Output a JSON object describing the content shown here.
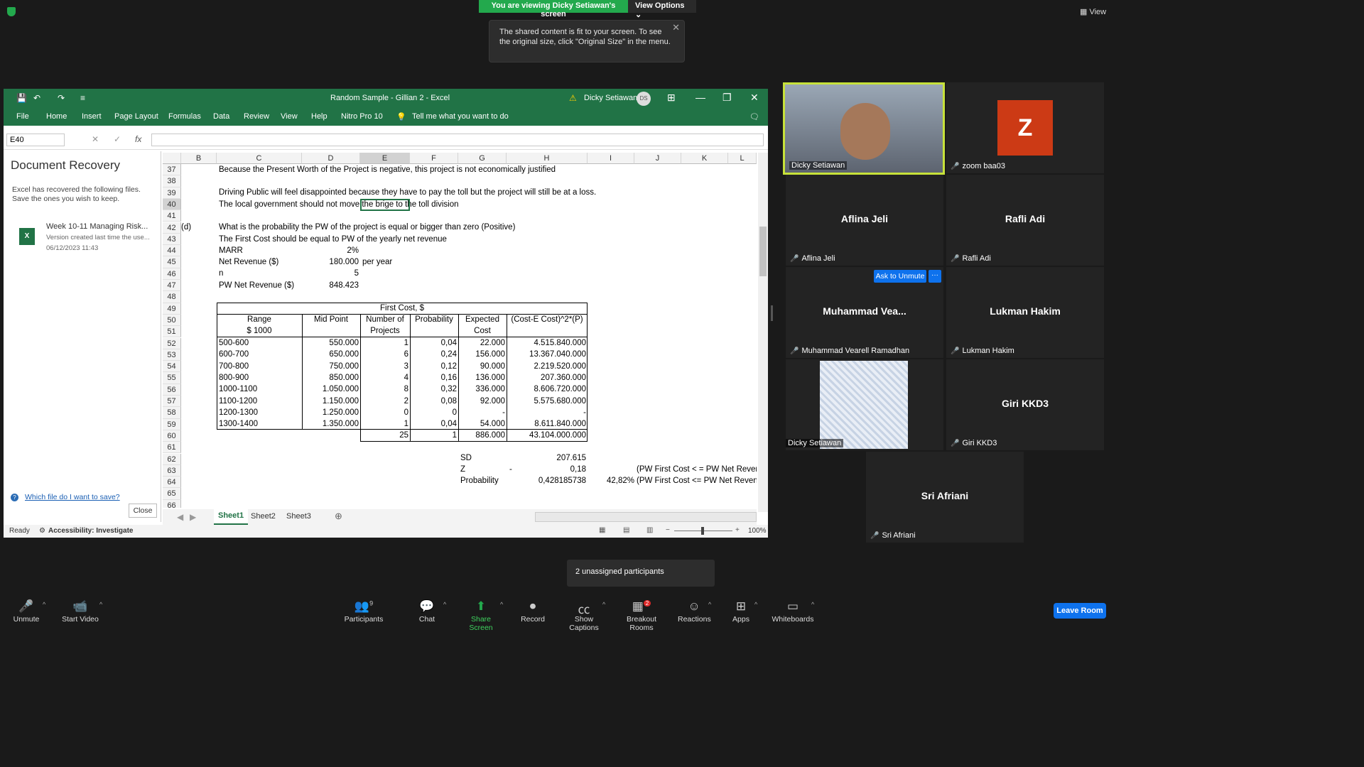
{
  "share": {
    "banner": "You are viewing Dicky Setiawan's screen",
    "view_options": "View Options",
    "view": "View",
    "tip": "The shared content is fit to your screen. To see the original size, click \"Original Size\" in the menu."
  },
  "excel": {
    "title": "Random Sample - Gillian 2  -  Excel",
    "user": "Dicky Setiawan",
    "user_initials": "DS",
    "menu": [
      "File",
      "Home",
      "Insert",
      "Page Layout",
      "Formulas",
      "Data",
      "Review",
      "View",
      "Help",
      "Nitro Pro 10",
      "Tell me what you want to do"
    ],
    "namebox": "E40",
    "fx": "fx",
    "recovery": {
      "title": "Document Recovery",
      "desc": "Excel has recovered the following files.  Save the ones you wish to keep.",
      "file": "Week 10-11 Managing Risk...",
      "version": "Version created last time the use...",
      "date": "06/12/2023 11:43",
      "help": "Which file do I want to save?",
      "close": "Close"
    },
    "columns": [
      "B",
      "C",
      "D",
      "E",
      "F",
      "G",
      "H",
      "I",
      "J",
      "K",
      "L"
    ],
    "rows": [
      "37",
      "38",
      "39",
      "40",
      "41",
      "42",
      "43",
      "44",
      "45",
      "46",
      "47",
      "48",
      "49",
      "50",
      "51",
      "52",
      "53",
      "54",
      "55",
      "56",
      "57",
      "58",
      "59",
      "60",
      "61",
      "62",
      "63",
      "64",
      "65",
      "66"
    ],
    "text": {
      "r37": "Because the Present Worth of the Project is negative, this project is not economically justified",
      "r39": "Driving Public will feel disappointed because they have to pay the toll but the project will still be at a loss.",
      "r40": "The local government should not move the brige to the toll division",
      "r42a": "(d)",
      "r42": "What is the probability the PW of the project is equal or bigger than zero  (Positive)",
      "r43": "The First Cost should be equal to PW of the yearly net  revenue",
      "r44a": "MARR",
      "r44b": "2%",
      "r45a": "Net Revenue ($)",
      "r45b": "180.000",
      "r45c": "per year",
      "r46a": "n",
      "r46b": "5",
      "r47a": "PW Net Revenue ($)",
      "r47b": "848.423",
      "r49": "First Cost, $",
      "h_range": "Range",
      "h_range2": "$ 1000",
      "h_mid": "Mid Point",
      "h_num": "Number of",
      "h_num2": "Projects",
      "h_prob": "Probability",
      "h_exp": "Expected",
      "h_exp2": "Cost",
      "h_var": "(Cost-E Cost)^2*(P)",
      "tot_n": "25",
      "tot_p": "1",
      "tot_e": "886.000",
      "tot_v": "43.104.000.000",
      "sd_l": "SD",
      "sd_v": "207.615",
      "z_l": "Z",
      "z_dash": "-",
      "z_v": "0,18",
      "z_note": "(PW First Cost < = PW Net Revenu",
      "p_l": "Probability",
      "p_v": "0,428185738",
      "p_pct": "42,82%",
      "p_note": "(PW First Cost <= PW Net Revenu"
    },
    "table": [
      [
        "500-600",
        "550.000",
        "1",
        "0,04",
        "22.000",
        "4.515.840.000"
      ],
      [
        "600-700",
        "650.000",
        "6",
        "0,24",
        "156.000",
        "13.367.040.000"
      ],
      [
        "700-800",
        "750.000",
        "3",
        "0,12",
        "90.000",
        "2.219.520.000"
      ],
      [
        "800-900",
        "850.000",
        "4",
        "0,16",
        "136.000",
        "207.360.000"
      ],
      [
        "1000-1100",
        "1.050.000",
        "8",
        "0,32",
        "336.000",
        "8.606.720.000"
      ],
      [
        "1100-1200",
        "1.150.000",
        "2",
        "0,08",
        "92.000",
        "5.575.680.000"
      ],
      [
        "1200-1300",
        "1.250.000",
        "0",
        "0",
        "-",
        "-"
      ],
      [
        "1300-1400",
        "1.350.000",
        "1",
        "0,04",
        "54.000",
        "8.611.840.000"
      ]
    ],
    "sheets": [
      "Sheet1",
      "Sheet2",
      "Sheet3"
    ],
    "status": {
      "ready": "Ready",
      "access": "Accessibility: Investigate",
      "zoom": "100%"
    }
  },
  "participants": [
    {
      "name": "Dicky Setiawan",
      "big": "",
      "video": true
    },
    {
      "name": "zoom baa03",
      "big": "Z"
    },
    {
      "name": "Aflina Jeli",
      "big": "Aflina Jeli"
    },
    {
      "name": "Rafli Adi",
      "big": "Rafli Adi"
    },
    {
      "name": "Muhammad Vearell Ramadhan",
      "big": "Muhammad  Vea..."
    },
    {
      "name": "Lukman Hakim",
      "big": "Lukman Hakim"
    },
    {
      "name": "Dicky Setiawan",
      "big": ""
    },
    {
      "name": "Giri KKD3",
      "big": "Giri KKD3"
    },
    {
      "name": "Sri Afriani",
      "big": "Sri Afriani"
    }
  ],
  "ask_unmute": "Ask to Unmute",
  "toolbar": {
    "unmute": "Unmute",
    "video": "Start Video",
    "participants": "Participants",
    "pcount": "9",
    "chat": "Chat",
    "share": "Share Screen",
    "record": "Record",
    "captions": "Show Captions",
    "breakout": "Breakout Rooms",
    "breakout_badge": "2",
    "reactions": "Reactions",
    "apps": "Apps",
    "whiteboards": "Whiteboards",
    "leave": "Leave Room"
  },
  "unassigned": "2 unassigned participants"
}
